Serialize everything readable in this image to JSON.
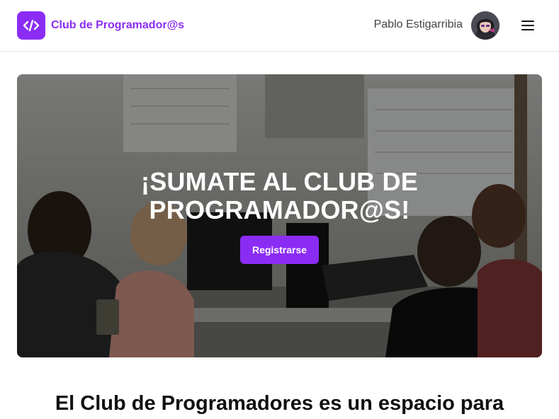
{
  "header": {
    "brand_name": "Club de Programador@s",
    "logo_icon": "code-icon",
    "user_name": "Pablo Estigarribia",
    "menu_icon": "hamburger-menu-icon"
  },
  "hero": {
    "title": "¡SUMATE AL CLUB DE PROGRAMADOR@S!",
    "cta_label": "Registrarse"
  },
  "intro": {
    "heading": "El Club de Programadores es un espacio para"
  },
  "colors": {
    "brand": "#8b2cf5",
    "text": "#111111"
  }
}
